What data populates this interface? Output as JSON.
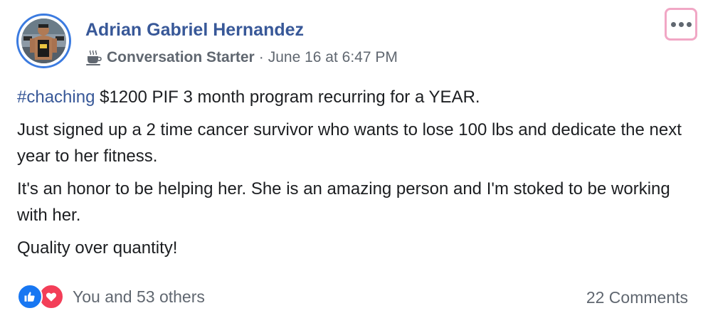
{
  "post": {
    "author": "Adrian Gabriel Hernandez",
    "badge": {
      "icon": "coffee-cup-icon",
      "label": "Conversation Starter"
    },
    "separator": "·",
    "timestamp": "June 16 at 6:47 PM",
    "more_icon": "more-options-icon",
    "hashtag": "#chaching",
    "line1_rest": " $1200 PIF 3 month program recurring for a YEAR.",
    "paragraph2": "Just signed up a 2 time cancer survivor who wants to lose 100 lbs and dedicate the next year to her fitness.",
    "paragraph3": "It's an honor to be helping her. She is an amazing person and I'm stoked to be working with her.",
    "paragraph4": "Quality over quantity!"
  },
  "footer": {
    "reactions": [
      "like-icon",
      "love-icon"
    ],
    "reaction_summary": "You and 53 others",
    "comments": "22 Comments"
  },
  "colors": {
    "link": "#385898",
    "meta": "#606770",
    "text": "#1c1e21",
    "like": "#1877f2",
    "love": "#f33e58",
    "avatar_ring": "#3b7be0",
    "focus_ring": "#f1a7c5"
  }
}
